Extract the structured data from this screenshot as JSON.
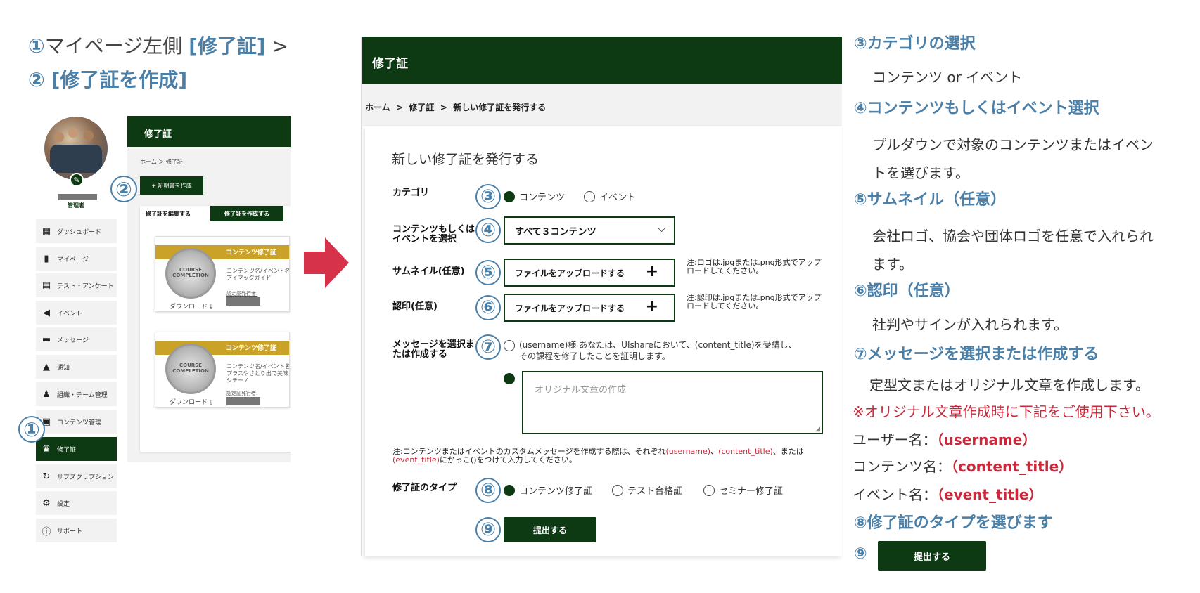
{
  "left_guide": {
    "step1_num": "①",
    "step1_text": "マイページ左側",
    "step1_highlight": "[修了証]",
    "step1_arrow": ">",
    "step2_num": "②",
    "step2_highlight": "[修了証を作成]",
    "role": "管理者",
    "sidebar": [
      {
        "icon": "dashboard-icon",
        "label": "ダッシュボード"
      },
      {
        "icon": "book-icon",
        "label": "マイページ"
      },
      {
        "icon": "clipboard-icon",
        "label": "テスト・アンケート"
      },
      {
        "icon": "megaphone-icon",
        "label": "イベント"
      },
      {
        "icon": "chat-icon",
        "label": "メッセージ"
      },
      {
        "icon": "bell-icon",
        "label": "通知"
      },
      {
        "icon": "team-icon",
        "label": "組織・チーム管理"
      },
      {
        "icon": "content-icon",
        "label": "コンテンツ管理"
      },
      {
        "icon": "medal-icon",
        "label": "修了証"
      },
      {
        "icon": "subscription-icon",
        "label": "サブスクリプション"
      },
      {
        "icon": "gear-icon",
        "label": "設定"
      },
      {
        "icon": "info-icon",
        "label": "サポート"
      }
    ],
    "panel_title": "修了証",
    "breadcrumb": "ホーム ＞ 修了証",
    "create_button": "+ 証明書を作成",
    "tab_edit": "修了証を編集する",
    "tab_create": "修了証を作成する",
    "cards": [
      {
        "band": "コンテンツ修了証",
        "medal": "COURSE COMPLETION",
        "desc1": "コンテンツ名/イベント名",
        "desc2": "アイマックガイド",
        "issuer": "認定証発行者:",
        "download": "ダウンロード"
      },
      {
        "band": "コンテンツ修了証",
        "medal": "COURSE COMPLETION",
        "desc1": "コンテンツ名/イベント名",
        "desc2": "プラスやさとり出で美味しい",
        "desc3": "シチーノ",
        "issuer": "認定証発行者:",
        "download": "ダウンロード"
      }
    ]
  },
  "main": {
    "header_title": "修了証",
    "breadcrumb": {
      "home": "ホーム",
      "sep": ">",
      "l2": "修了証",
      "l3": "新しい修了証を発行する"
    },
    "form_title": "新しい修了証を発行する",
    "category_label": "カテゴリ",
    "category_options": [
      "コンテンツ",
      "イベント"
    ],
    "select_label_1": "コンテンツもしくは",
    "select_label_2": "イベントを選択",
    "select_value": "すべて３コンテンツ",
    "thumb_label": "サムネイル(任意)",
    "upload_text": "ファイルをアップロードする",
    "thumb_note_1": "注:ロゴは.jpgまたは.png形式でアップ",
    "thumb_note_2": "ロードしてください。",
    "seal_label": "認印(任意)",
    "seal_note_1": "注:認印は.jpgまたは.png形式でアップ",
    "seal_note_2": "ロードしてください。",
    "message_label_1": "メッセージを選択ま",
    "message_label_2": "たは作成する",
    "message_template_1": "(username)様 あなたは、UIshareにおいて、(content_title)を受講し、",
    "message_template_2": "その課程を修了したことを証明します。",
    "textarea_placeholder": "オリジナル文章の作成",
    "custom_note_1a": "注:コンテンツまたはイベントのカスタムメッセージを作成する際は、それぞれ",
    "custom_note_username": "(username)",
    "custom_note_sep": "、",
    "custom_note_content": "(content_title)",
    "custom_note_or": "、または",
    "custom_note_event": "(event_title)",
    "custom_note_2": "にかっこ()をつけて入力してください。",
    "type_label": "修了証のタイプ",
    "type_options": [
      "コンテンツ修了証",
      "テスト合格証",
      "セミナー修了証"
    ],
    "submit": "提出する",
    "step_numbers": [
      "③",
      "④",
      "⑤",
      "⑥",
      "⑦",
      "⑧",
      "⑨"
    ]
  },
  "right_guide": {
    "h3": "③カテゴリの選択",
    "t3": "コンテンツ or イベント",
    "h4": "④コンテンツもしくはイベント選択",
    "t4a": "プルダウンで対象のコンテンツまたはイベン",
    "t4b": "トを選びます。",
    "h5": "⑤サムネイル（任意）",
    "t5a": "会社ロゴ、協会や団体ロゴを任意で入れられ",
    "t5b": "ます。",
    "h6": "⑥認印（任意）",
    "t6": "社判やサインが入れられます。",
    "h7": "⑦メッセージを選択または作成する",
    "t7": "定型文またはオリジナル文章を作成します。",
    "r7": "※オリジナル文章作成時に下記をご使用下さい。",
    "k1_label": "ユーザー名：",
    "k1_value": "（username）",
    "k2_label": "コンテンツ名：",
    "k2_value": "（content_title）",
    "k3_label": "イベント名：",
    "k3_value": "（event_title）",
    "h8": "⑧修了証のタイプを選びます",
    "n9": "⑨",
    "submit": "提出する"
  },
  "colors": {
    "primary": "#0d3a12",
    "accent_blue": "#4a7fa8",
    "red": "#c8283a",
    "arrow": "#d6334a",
    "gold": "#c9a227"
  }
}
